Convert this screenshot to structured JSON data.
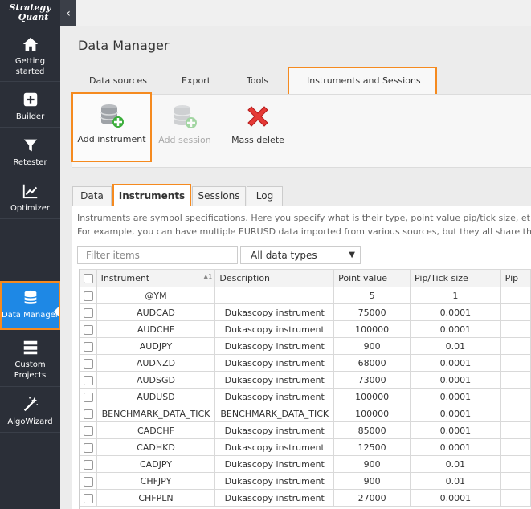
{
  "app": {
    "logo_line1": "Strategy",
    "logo_line2": "Quant"
  },
  "sidebar": {
    "items": [
      {
        "label": "Getting started",
        "icon": "home-icon"
      },
      {
        "label": "Builder",
        "icon": "plus-square-icon"
      },
      {
        "label": "Retester",
        "icon": "filter-icon"
      },
      {
        "label": "Optimizer",
        "icon": "chart-line-icon"
      },
      {
        "label": "Data Manager",
        "icon": "database-icon",
        "active": true
      },
      {
        "label": "Custom Projects",
        "icon": "server-icon"
      },
      {
        "label": "AlgoWizard",
        "icon": "magic-wand-icon"
      }
    ]
  },
  "page": {
    "title": "Data Manager"
  },
  "top_tabs": [
    "Data sources",
    "Export",
    "Tools",
    "Instruments and Sessions"
  ],
  "toolbar": {
    "add_instrument": "Add instrument",
    "add_session": "Add session",
    "mass_delete": "Mass delete"
  },
  "sub_tabs": [
    "Data",
    "Instruments",
    "Sessions",
    "Log"
  ],
  "info": {
    "line1": "Instruments are symbol specifications. Here you specify what is their type, point value pip/tick size, et",
    "line2": "For example, you can have multiple EURUSD data imported from various sources, but they all share th"
  },
  "filter": {
    "placeholder": "Filter items",
    "type_value": "All data types"
  },
  "grid": {
    "columns": [
      "Instrument",
      "Description",
      "Point value",
      "Pip/Tick size",
      "Pip"
    ],
    "rows": [
      [
        "@YM",
        "",
        "5",
        "1"
      ],
      [
        "AUDCAD",
        "Dukascopy instrument",
        "75000",
        "0.0001"
      ],
      [
        "AUDCHF",
        "Dukascopy instrument",
        "100000",
        "0.0001"
      ],
      [
        "AUDJPY",
        "Dukascopy instrument",
        "900",
        "0.01"
      ],
      [
        "AUDNZD",
        "Dukascopy instrument",
        "68000",
        "0.0001"
      ],
      [
        "AUDSGD",
        "Dukascopy instrument",
        "73000",
        "0.0001"
      ],
      [
        "AUDUSD",
        "Dukascopy instrument",
        "100000",
        "0.0001"
      ],
      [
        "BENCHMARK_DATA_TICK",
        "BENCHMARK_DATA_TICK",
        "100000",
        "0.0001"
      ],
      [
        "CADCHF",
        "Dukascopy instrument",
        "85000",
        "0.0001"
      ],
      [
        "CADHKD",
        "Dukascopy instrument",
        "12500",
        "0.0001"
      ],
      [
        "CADJPY",
        "Dukascopy instrument",
        "900",
        "0.01"
      ],
      [
        "CHFJPY",
        "Dukascopy instrument",
        "900",
        "0.01"
      ],
      [
        "CHFPLN",
        "Dukascopy instrument",
        "27000",
        "0.0001"
      ]
    ]
  },
  "colors": {
    "sidebar_bg": "#2b2f38",
    "active_blue": "#1e88e5",
    "highlight_orange": "#f58a1f"
  }
}
